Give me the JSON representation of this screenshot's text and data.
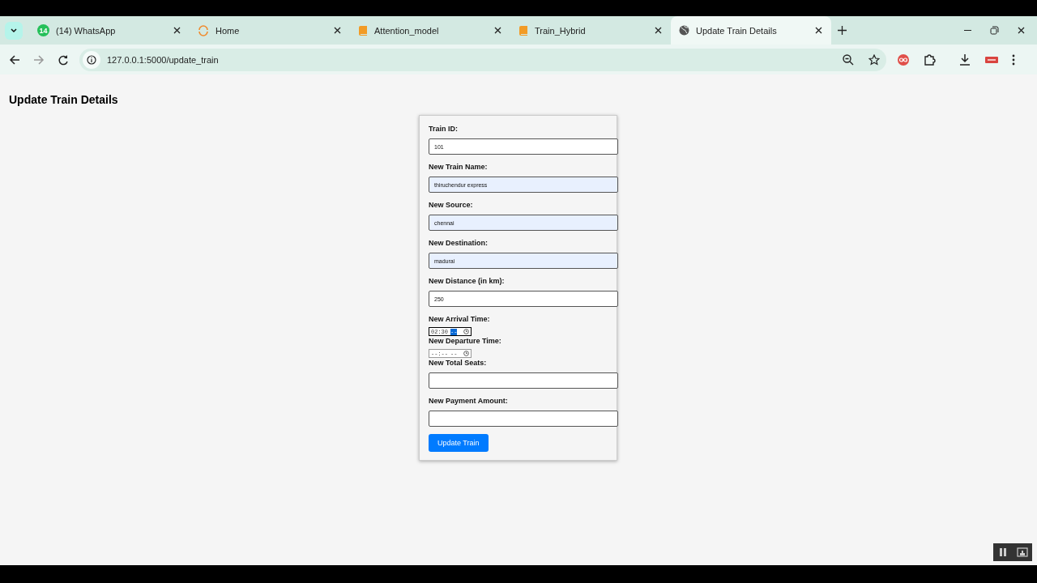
{
  "tabs": [
    {
      "label": "(14) WhatsApp",
      "badge": "14",
      "selected": false
    },
    {
      "label": "Home",
      "selected": false
    },
    {
      "label": "Attention_model",
      "selected": false
    },
    {
      "label": "Train_Hybrid",
      "selected": false
    },
    {
      "label": "Update Train Details",
      "selected": true
    }
  ],
  "address_bar": {
    "url": "127.0.0.1:5000/update_train"
  },
  "page": {
    "heading": "Update Train Details"
  },
  "form": {
    "fields": [
      {
        "kind": "text",
        "label": "Train ID:",
        "value": "101",
        "autofilled": false
      },
      {
        "kind": "text",
        "label": "New Train Name:",
        "value": "thiruchendur express",
        "autofilled": true
      },
      {
        "kind": "text",
        "label": "New Source:",
        "value": "chennai",
        "autofilled": true
      },
      {
        "kind": "text",
        "label": "New Destination:",
        "value": "madurai",
        "autofilled": true
      },
      {
        "kind": "text",
        "label": "New Distance (in km):",
        "value": "250",
        "autofilled": false
      },
      {
        "kind": "time",
        "label": "New Arrival Time:",
        "value": "02:30",
        "period": "--",
        "period_selected": true
      },
      {
        "kind": "time",
        "label": "New Departure Time:",
        "value": "--:--",
        "period": "--",
        "period_selected": false
      },
      {
        "kind": "text",
        "label": "New Total Seats:",
        "autofilled": false
      },
      {
        "kind": "text",
        "label": "New Payment Amount:",
        "autofilled": false
      }
    ],
    "submit": "Update Train"
  }
}
